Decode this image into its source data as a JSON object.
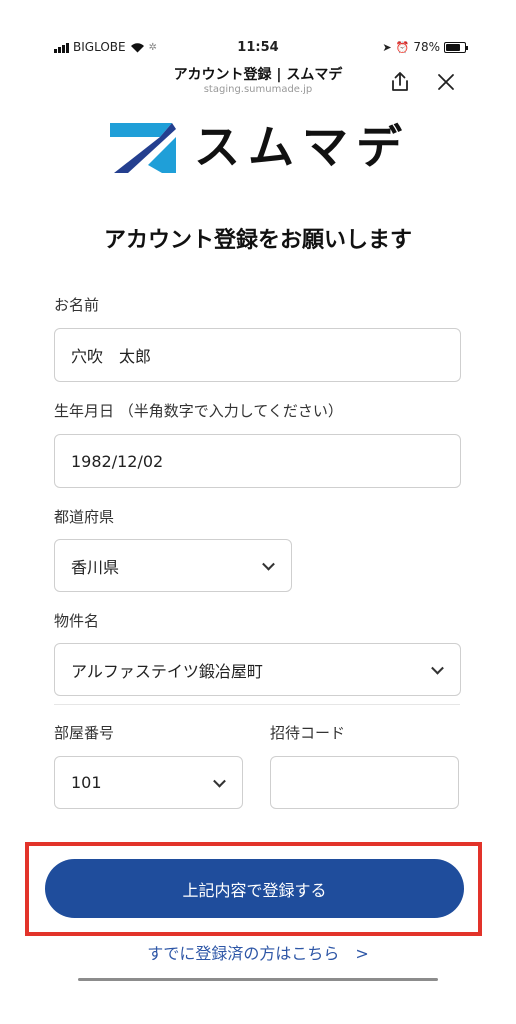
{
  "status_bar": {
    "carrier": "BIGLOBE",
    "time": "11:54",
    "battery": "78%",
    "battery_level": 0.78
  },
  "browser": {
    "title": "アカウント登録 | スムマデ",
    "url": "staging.sumumade.jp",
    "share_icon": "share-icon",
    "close_icon": "close-icon"
  },
  "brand": {
    "name": "スムマデ",
    "mark_colors": [
      "#1f9fd8",
      "#243f8f"
    ]
  },
  "form": {
    "heading": "アカウント登録をお願いします",
    "name": {
      "label": "お名前",
      "value": "穴吹　太郎"
    },
    "birthdate": {
      "label": "生年月日 （半角数字で入力してください）",
      "value": "1982/12/02"
    },
    "prefecture": {
      "label": "都道府県",
      "value": "香川県"
    },
    "property": {
      "label": "物件名",
      "value": "アルファステイツ鍛冶屋町"
    },
    "room": {
      "label": "部屋番号",
      "value": "101"
    },
    "invite": {
      "label": "招待コード",
      "value": ""
    },
    "submit_label": "上記内容で登録する",
    "login_link": "すでに登録済の方はこちら",
    "login_arrow": ">"
  },
  "colors": {
    "primary": "#1f4d9c",
    "highlight": "#e2332a",
    "link": "#2d56a6"
  }
}
